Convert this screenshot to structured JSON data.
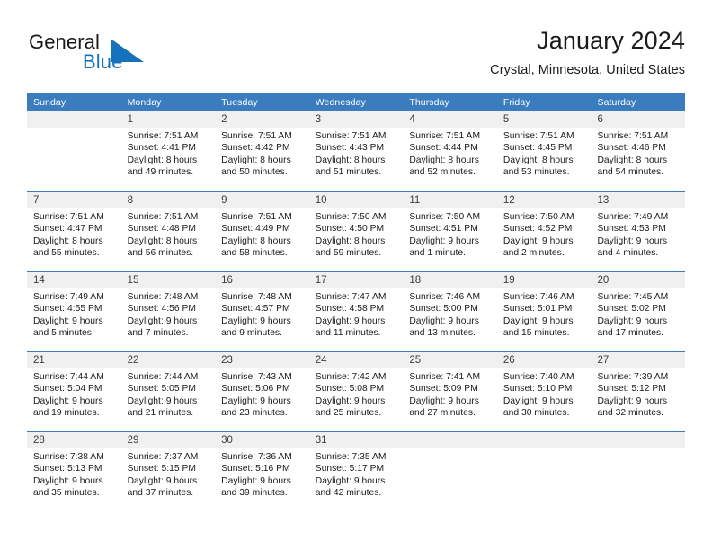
{
  "brand": {
    "name_part1": "General",
    "name_part2": "Blue",
    "mark": "triangle-flag-icon",
    "accent_color": "#1673bb"
  },
  "header": {
    "title": "January 2024",
    "subtitle": "Crystal, Minnesota, United States"
  },
  "theme": {
    "header_row_bg": "#3a7cbe",
    "header_row_text": "#ffffff",
    "daynum_band_bg": "#f0f0f0",
    "cell_bg": "#ffffff",
    "week_divider": "#3a7cbe"
  },
  "calendar": {
    "weekday_headers": [
      "Sunday",
      "Monday",
      "Tuesday",
      "Wednesday",
      "Thursday",
      "Friday",
      "Saturday"
    ],
    "weeks": [
      [
        {
          "day": "",
          "lines": []
        },
        {
          "day": "1",
          "lines": [
            "Sunrise: 7:51 AM",
            "Sunset: 4:41 PM",
            "Daylight: 8 hours",
            "and 49 minutes."
          ]
        },
        {
          "day": "2",
          "lines": [
            "Sunrise: 7:51 AM",
            "Sunset: 4:42 PM",
            "Daylight: 8 hours",
            "and 50 minutes."
          ]
        },
        {
          "day": "3",
          "lines": [
            "Sunrise: 7:51 AM",
            "Sunset: 4:43 PM",
            "Daylight: 8 hours",
            "and 51 minutes."
          ]
        },
        {
          "day": "4",
          "lines": [
            "Sunrise: 7:51 AM",
            "Sunset: 4:44 PM",
            "Daylight: 8 hours",
            "and 52 minutes."
          ]
        },
        {
          "day": "5",
          "lines": [
            "Sunrise: 7:51 AM",
            "Sunset: 4:45 PM",
            "Daylight: 8 hours",
            "and 53 minutes."
          ]
        },
        {
          "day": "6",
          "lines": [
            "Sunrise: 7:51 AM",
            "Sunset: 4:46 PM",
            "Daylight: 8 hours",
            "and 54 minutes."
          ]
        }
      ],
      [
        {
          "day": "7",
          "lines": [
            "Sunrise: 7:51 AM",
            "Sunset: 4:47 PM",
            "Daylight: 8 hours",
            "and 55 minutes."
          ]
        },
        {
          "day": "8",
          "lines": [
            "Sunrise: 7:51 AM",
            "Sunset: 4:48 PM",
            "Daylight: 8 hours",
            "and 56 minutes."
          ]
        },
        {
          "day": "9",
          "lines": [
            "Sunrise: 7:51 AM",
            "Sunset: 4:49 PM",
            "Daylight: 8 hours",
            "and 58 minutes."
          ]
        },
        {
          "day": "10",
          "lines": [
            "Sunrise: 7:50 AM",
            "Sunset: 4:50 PM",
            "Daylight: 8 hours",
            "and 59 minutes."
          ]
        },
        {
          "day": "11",
          "lines": [
            "Sunrise: 7:50 AM",
            "Sunset: 4:51 PM",
            "Daylight: 9 hours",
            "and 1 minute."
          ]
        },
        {
          "day": "12",
          "lines": [
            "Sunrise: 7:50 AM",
            "Sunset: 4:52 PM",
            "Daylight: 9 hours",
            "and 2 minutes."
          ]
        },
        {
          "day": "13",
          "lines": [
            "Sunrise: 7:49 AM",
            "Sunset: 4:53 PM",
            "Daylight: 9 hours",
            "and 4 minutes."
          ]
        }
      ],
      [
        {
          "day": "14",
          "lines": [
            "Sunrise: 7:49 AM",
            "Sunset: 4:55 PM",
            "Daylight: 9 hours",
            "and 5 minutes."
          ]
        },
        {
          "day": "15",
          "lines": [
            "Sunrise: 7:48 AM",
            "Sunset: 4:56 PM",
            "Daylight: 9 hours",
            "and 7 minutes."
          ]
        },
        {
          "day": "16",
          "lines": [
            "Sunrise: 7:48 AM",
            "Sunset: 4:57 PM",
            "Daylight: 9 hours",
            "and 9 minutes."
          ]
        },
        {
          "day": "17",
          "lines": [
            "Sunrise: 7:47 AM",
            "Sunset: 4:58 PM",
            "Daylight: 9 hours",
            "and 11 minutes."
          ]
        },
        {
          "day": "18",
          "lines": [
            "Sunrise: 7:46 AM",
            "Sunset: 5:00 PM",
            "Daylight: 9 hours",
            "and 13 minutes."
          ]
        },
        {
          "day": "19",
          "lines": [
            "Sunrise: 7:46 AM",
            "Sunset: 5:01 PM",
            "Daylight: 9 hours",
            "and 15 minutes."
          ]
        },
        {
          "day": "20",
          "lines": [
            "Sunrise: 7:45 AM",
            "Sunset: 5:02 PM",
            "Daylight: 9 hours",
            "and 17 minutes."
          ]
        }
      ],
      [
        {
          "day": "21",
          "lines": [
            "Sunrise: 7:44 AM",
            "Sunset: 5:04 PM",
            "Daylight: 9 hours",
            "and 19 minutes."
          ]
        },
        {
          "day": "22",
          "lines": [
            "Sunrise: 7:44 AM",
            "Sunset: 5:05 PM",
            "Daylight: 9 hours",
            "and 21 minutes."
          ]
        },
        {
          "day": "23",
          "lines": [
            "Sunrise: 7:43 AM",
            "Sunset: 5:06 PM",
            "Daylight: 9 hours",
            "and 23 minutes."
          ]
        },
        {
          "day": "24",
          "lines": [
            "Sunrise: 7:42 AM",
            "Sunset: 5:08 PM",
            "Daylight: 9 hours",
            "and 25 minutes."
          ]
        },
        {
          "day": "25",
          "lines": [
            "Sunrise: 7:41 AM",
            "Sunset: 5:09 PM",
            "Daylight: 9 hours",
            "and 27 minutes."
          ]
        },
        {
          "day": "26",
          "lines": [
            "Sunrise: 7:40 AM",
            "Sunset: 5:10 PM",
            "Daylight: 9 hours",
            "and 30 minutes."
          ]
        },
        {
          "day": "27",
          "lines": [
            "Sunrise: 7:39 AM",
            "Sunset: 5:12 PM",
            "Daylight: 9 hours",
            "and 32 minutes."
          ]
        }
      ],
      [
        {
          "day": "28",
          "lines": [
            "Sunrise: 7:38 AM",
            "Sunset: 5:13 PM",
            "Daylight: 9 hours",
            "and 35 minutes."
          ]
        },
        {
          "day": "29",
          "lines": [
            "Sunrise: 7:37 AM",
            "Sunset: 5:15 PM",
            "Daylight: 9 hours",
            "and 37 minutes."
          ]
        },
        {
          "day": "30",
          "lines": [
            "Sunrise: 7:36 AM",
            "Sunset: 5:16 PM",
            "Daylight: 9 hours",
            "and 39 minutes."
          ]
        },
        {
          "day": "31",
          "lines": [
            "Sunrise: 7:35 AM",
            "Sunset: 5:17 PM",
            "Daylight: 9 hours",
            "and 42 minutes."
          ]
        },
        {
          "day": "",
          "lines": []
        },
        {
          "day": "",
          "lines": []
        },
        {
          "day": "",
          "lines": []
        }
      ]
    ]
  }
}
